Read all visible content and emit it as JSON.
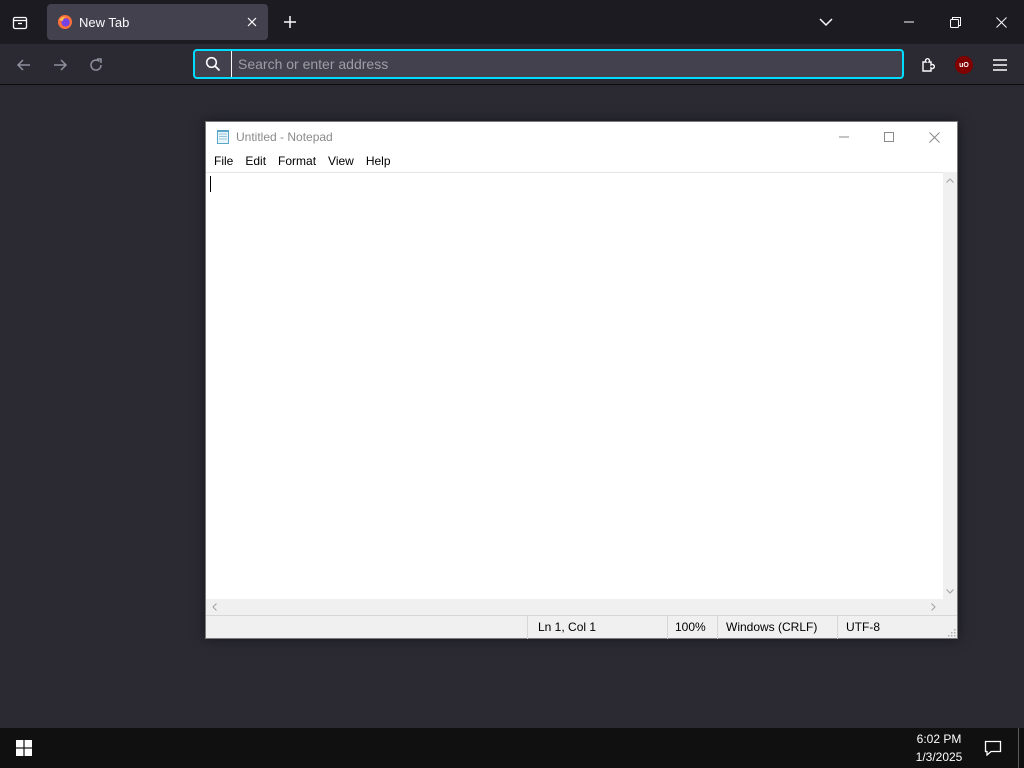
{
  "browser": {
    "tab": {
      "title": "New Tab"
    },
    "urlbar": {
      "placeholder": "Search or enter address",
      "value": ""
    },
    "extension_badge": "uO"
  },
  "notepad": {
    "title": "Untitled - Notepad",
    "menu": [
      "File",
      "Edit",
      "Format",
      "View",
      "Help"
    ],
    "content": "",
    "status": {
      "position": "Ln 1, Col 1",
      "zoom": "100%",
      "line_ending": "Windows (CRLF)",
      "encoding": "UTF-8"
    }
  },
  "taskbar": {
    "time": "6:02 PM",
    "date": "1/3/2025"
  },
  "colors": {
    "accent": "#00ddff",
    "chrome_dark": "#1c1b22",
    "chrome": "#2b2a33",
    "tab_active": "#42414d"
  }
}
